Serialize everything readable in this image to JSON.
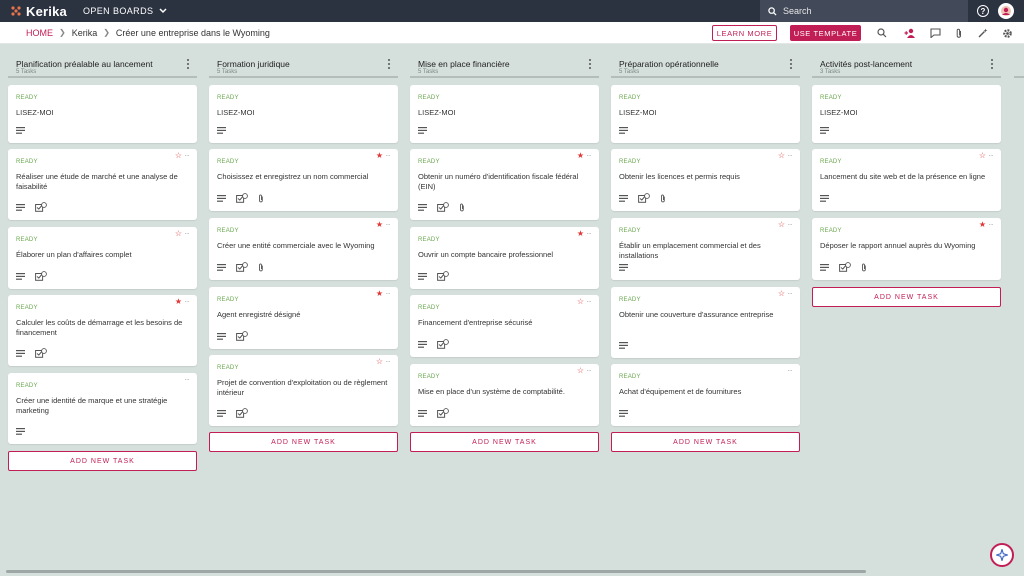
{
  "app": {
    "logo": "Kerika",
    "boards_menu": "OPEN BOARDS",
    "search_placeholder": "Search",
    "help": "?"
  },
  "breadcrumb": {
    "home": "HOME",
    "account": "Kerika",
    "board": "Créer une entreprise dans le Wyoming"
  },
  "actions": {
    "learn_more": "LEARN MORE",
    "use_template": "USE TEMPLATE"
  },
  "colors": {
    "brand": "#c21e56",
    "topbar": "#2b3240",
    "ready": "#6aa84f",
    "star": "#e03535",
    "background": "#d5dfdc"
  },
  "add_task_label": "ADD NEW TASK",
  "columns": [
    {
      "title": "Planification préalable au lancement",
      "count": "5 Tasks",
      "cards": [
        {
          "status": "READY",
          "title": "LISEZ-MOI",
          "star": "none",
          "attach": false,
          "check": false
        },
        {
          "status": "READY",
          "title": "Réaliser une étude de marché et une analyse de faisabilité",
          "star": "empty",
          "attach": false,
          "check": true
        },
        {
          "status": "READY",
          "title": "Élaborer un plan d'affaires complet",
          "star": "empty",
          "attach": false,
          "check": true
        },
        {
          "status": "READY",
          "title": "Calculer les coûts de démarrage et les besoins de financement",
          "star": "filled",
          "attach": false,
          "check": true
        },
        {
          "status": "READY",
          "title": "Créer une identité de marque et une stratégie marketing",
          "star": "none",
          "attach": false,
          "check": false
        }
      ]
    },
    {
      "title": "Formation juridique",
      "count": "5 Tasks",
      "cards": [
        {
          "status": "READY",
          "title": "LISEZ-MOI",
          "star": "none",
          "attach": false,
          "check": false
        },
        {
          "status": "READY",
          "title": "Choisissez et enregistrez un nom commercial",
          "star": "filled",
          "attach": true,
          "check": true
        },
        {
          "status": "READY",
          "title": "Créer une entité commerciale avec le Wyoming",
          "star": "filled",
          "attach": true,
          "check": true
        },
        {
          "status": "READY",
          "title": "Agent enregistré désigné",
          "star": "filled",
          "attach": false,
          "check": true
        },
        {
          "status": "READY",
          "title": "Projet de convention d'exploitation ou de règlement intérieur",
          "star": "empty",
          "attach": false,
          "check": true
        }
      ]
    },
    {
      "title": "Mise en place financière",
      "count": "5 Tasks",
      "cards": [
        {
          "status": "READY",
          "title": "LISEZ-MOI",
          "star": "none",
          "attach": false,
          "check": false
        },
        {
          "status": "READY",
          "title": "Obtenir un numéro d'identification fiscale fédéral (EIN)",
          "star": "filled",
          "attach": true,
          "check": true
        },
        {
          "status": "READY",
          "title": "Ouvrir un compte bancaire professionnel",
          "star": "filled",
          "attach": false,
          "check": true
        },
        {
          "status": "READY",
          "title": "Financement d'entreprise sécurisé",
          "star": "empty",
          "attach": false,
          "check": true
        },
        {
          "status": "READY",
          "title": "Mise en place d'un système de comptabilité.",
          "star": "empty",
          "attach": false,
          "check": true
        }
      ]
    },
    {
      "title": "Préparation opérationnelle",
      "count": "5 Tasks",
      "cards": [
        {
          "status": "READY",
          "title": "LISEZ-MOI",
          "star": "none",
          "attach": false,
          "check": false
        },
        {
          "status": "READY",
          "title": "Obtenir les licences et permis requis",
          "star": "empty",
          "attach": true,
          "check": true
        },
        {
          "status": "READY",
          "title": "Établir un emplacement commercial et des installations",
          "star": "empty",
          "attach": false,
          "check": false
        },
        {
          "status": "READY",
          "title": "Obtenir une couverture d'assurance entreprise",
          "star": "empty",
          "attach": false,
          "check": false
        },
        {
          "status": "READY",
          "title": "Achat d'équipement et de fournitures",
          "star": "none",
          "attach": false,
          "check": false
        }
      ]
    },
    {
      "title": "Activités post-lancement",
      "count": "3 Tasks",
      "cards": [
        {
          "status": "READY",
          "title": "LISEZ-MOI",
          "star": "none",
          "attach": false,
          "check": false
        },
        {
          "status": "READY",
          "title": "Lancement du site web et de la présence en ligne",
          "star": "empty",
          "attach": false,
          "check": false
        },
        {
          "status": "READY",
          "title": "Déposer le rapport annuel auprès du Wyoming",
          "star": "filled",
          "attach": true,
          "check": true
        }
      ]
    }
  ]
}
